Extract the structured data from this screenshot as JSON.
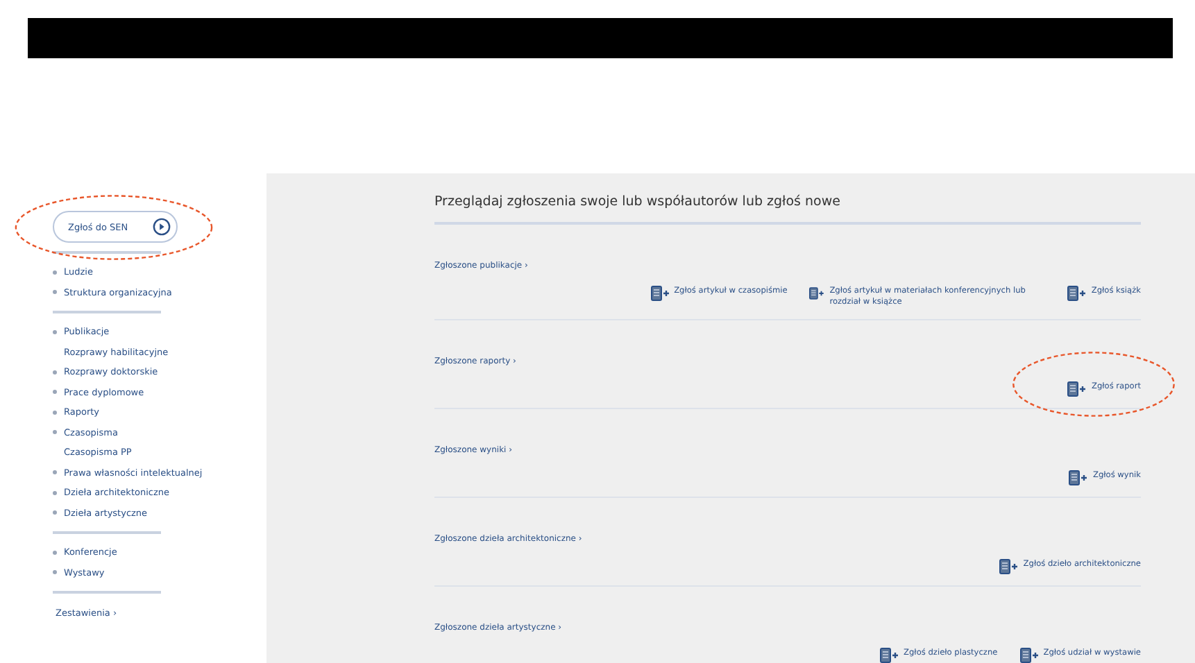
{
  "sidebar": {
    "report_button": {
      "label": "Zgłoś do SEN",
      "highlighted": true
    },
    "groups": [
      {
        "items": [
          {
            "label": "Ludzie",
            "kind": "bullet"
          },
          {
            "label": "Struktura organizacyjna",
            "kind": "bullet"
          }
        ]
      },
      {
        "items": [
          {
            "label": "Publikacje",
            "kind": "bullet"
          },
          {
            "label": "Rozprawy habilitacyjne",
            "kind": "sub"
          },
          {
            "label": "Rozprawy doktorskie",
            "kind": "bullet"
          },
          {
            "label": "Prace dyplomowe",
            "kind": "bullet"
          },
          {
            "label": "Raporty",
            "kind": "bullet"
          },
          {
            "label": "Czasopisma",
            "kind": "bullet"
          },
          {
            "label": "Czasopisma PP",
            "kind": "sub"
          },
          {
            "label": "Prawa własności intelektualnej",
            "kind": "bullet"
          },
          {
            "label": "Dzieła architektoniczne",
            "kind": "bullet"
          },
          {
            "label": "Dzieła artystyczne",
            "kind": "bullet"
          }
        ]
      },
      {
        "items": [
          {
            "label": "Konferencje",
            "kind": "bullet"
          },
          {
            "label": "Wystawy",
            "kind": "bullet"
          }
        ]
      }
    ],
    "footer_link": "Zestawienia ›"
  },
  "main": {
    "heading": "Przeglądaj zgłoszenia swoje lub współautorów lub zgłoś nowe",
    "sections": [
      {
        "title": "Zgłoszone publikacje ›",
        "actions": [
          {
            "label": "Zgłoś artykuł w czasopiśmie",
            "highlighted": false
          },
          {
            "label": "Zgłoś artykuł w materiałach konferencyjnych lub rozdział w książce",
            "highlighted": false
          },
          {
            "label": "Zgłoś książk",
            "highlighted": false
          }
        ]
      },
      {
        "title": "Zgłoszone raporty ›",
        "actions": [
          {
            "label": "Zgłoś raport",
            "highlighted": true
          }
        ]
      },
      {
        "title": "Zgłoszone wyniki ›",
        "actions": [
          {
            "label": "Zgłoś wynik",
            "highlighted": false
          }
        ]
      },
      {
        "title": "Zgłoszone dzieła architektoniczne ›",
        "actions": [
          {
            "label": "Zgłoś dzieło architektoniczne",
            "highlighted": false
          }
        ]
      },
      {
        "title": "Zgłoszone dzieła artystyczne ›",
        "actions": [
          {
            "label": "Zgłoś dzieło plastyczne",
            "highlighted": false
          },
          {
            "label": "Zgłoś udział w wystawie",
            "highlighted": false
          }
        ]
      }
    ]
  }
}
